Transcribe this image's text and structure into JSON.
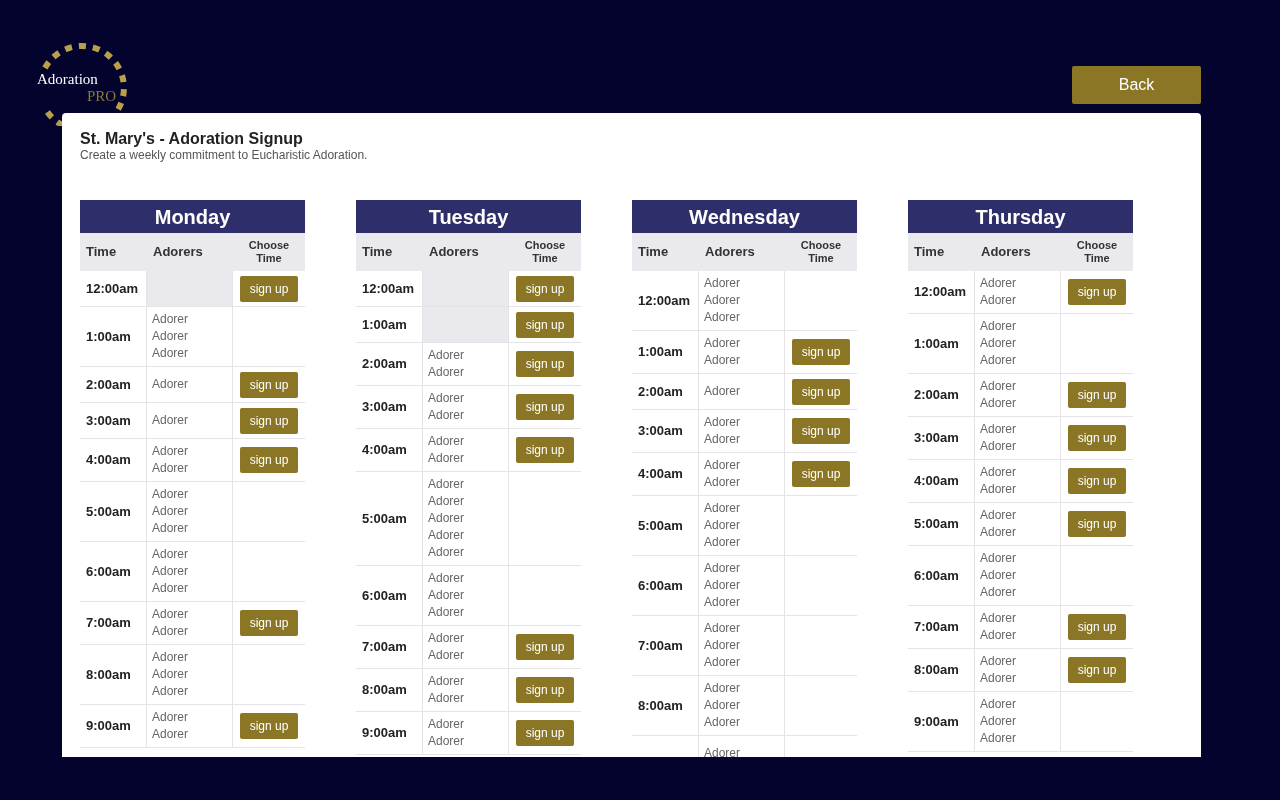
{
  "logo": {
    "line1": "Adoration",
    "line2": "PRO"
  },
  "back_button": "Back",
  "page": {
    "title": "St. Mary's - Adoration Signup",
    "subtitle": "Create a weekly commitment to Eucharistic Adoration."
  },
  "days": [
    {
      "name": "Monday",
      "columns": [
        "Time",
        "Adorers",
        "Choose Time"
      ],
      "rows": [
        {
          "time": "12:00am",
          "adorers": [],
          "action": "sign up"
        },
        {
          "time": "1:00am",
          "adorers": [
            "Adorer",
            "Adorer",
            "Adorer"
          ]
        },
        {
          "time": "2:00am",
          "adorers": [
            "Adorer"
          ],
          "action": "sign up"
        },
        {
          "time": "3:00am",
          "adorers": [
            "Adorer"
          ],
          "action": "sign up"
        },
        {
          "time": "4:00am",
          "adorers": [
            "Adorer",
            "Adorer"
          ],
          "action": "sign up"
        },
        {
          "time": "5:00am",
          "adorers": [
            "Adorer",
            "Adorer",
            "Adorer"
          ]
        },
        {
          "time": "6:00am",
          "adorers": [
            "Adorer",
            "Adorer",
            "Adorer"
          ]
        },
        {
          "time": "7:00am",
          "adorers": [
            "Adorer",
            "Adorer"
          ],
          "action": "sign up"
        },
        {
          "time": "8:00am",
          "adorers": [
            "Adorer",
            "Adorer",
            "Adorer"
          ]
        },
        {
          "time": "9:00am",
          "adorers": [
            "Adorer",
            "Adorer"
          ],
          "action": "sign up"
        }
      ]
    },
    {
      "name": "Tuesday",
      "columns": [
        "Time",
        "Adorers",
        "Choose Time"
      ],
      "rows": [
        {
          "time": "12:00am",
          "adorers": [],
          "action": "sign up"
        },
        {
          "time": "1:00am",
          "adorers": [],
          "action": "sign up"
        },
        {
          "time": "2:00am",
          "adorers": [
            "Adorer",
            "Adorer"
          ],
          "action": "sign up"
        },
        {
          "time": "3:00am",
          "adorers": [
            "Adorer",
            "Adorer"
          ],
          "action": "sign up"
        },
        {
          "time": "4:00am",
          "adorers": [
            "Adorer",
            "Adorer"
          ],
          "action": "sign up"
        },
        {
          "time": "5:00am",
          "adorers": [
            "Adorer",
            "Adorer",
            "Adorer",
            "Adorer",
            "Adorer"
          ]
        },
        {
          "time": "6:00am",
          "adorers": [
            "Adorer",
            "Adorer",
            "Adorer"
          ]
        },
        {
          "time": "7:00am",
          "adorers": [
            "Adorer",
            "Adorer"
          ],
          "action": "sign up"
        },
        {
          "time": "8:00am",
          "adorers": [
            "Adorer",
            "Adorer"
          ],
          "action": "sign up"
        },
        {
          "time": "9:00am",
          "adorers": [
            "Adorer",
            "Adorer"
          ],
          "action": "sign up"
        }
      ]
    },
    {
      "name": "Wednesday",
      "columns": [
        "Time",
        "Adorers",
        "Choose Time"
      ],
      "rows": [
        {
          "time": "12:00am",
          "adorers": [
            "Adorer",
            "Adorer",
            "Adorer"
          ]
        },
        {
          "time": "1:00am",
          "adorers": [
            "Adorer",
            "Adorer"
          ],
          "action": "sign up"
        },
        {
          "time": "2:00am",
          "adorers": [
            "Adorer"
          ],
          "action": "sign up"
        },
        {
          "time": "3:00am",
          "adorers": [
            "Adorer",
            "Adorer"
          ],
          "action": "sign up"
        },
        {
          "time": "4:00am",
          "adorers": [
            "Adorer",
            "Adorer"
          ],
          "action": "sign up"
        },
        {
          "time": "5:00am",
          "adorers": [
            "Adorer",
            "Adorer",
            "Adorer"
          ]
        },
        {
          "time": "6:00am",
          "adorers": [
            "Adorer",
            "Adorer",
            "Adorer"
          ]
        },
        {
          "time": "7:00am",
          "adorers": [
            "Adorer",
            "Adorer",
            "Adorer"
          ]
        },
        {
          "time": "8:00am",
          "adorers": [
            "Adorer",
            "Adorer",
            "Adorer"
          ]
        },
        {
          "adorers": [
            "Adorer"
          ]
        }
      ]
    },
    {
      "name": "Thursday",
      "columns": [
        "Time",
        "Adorers",
        "Choose Time"
      ],
      "rows": [
        {
          "time": "12:00am",
          "adorers": [
            "Adorer",
            "Adorer"
          ],
          "action": "sign up"
        },
        {
          "time": "1:00am",
          "adorers": [
            "Adorer",
            "Adorer",
            "Adorer"
          ]
        },
        {
          "time": "2:00am",
          "adorers": [
            "Adorer",
            "Adorer"
          ],
          "action": "sign up"
        },
        {
          "time": "3:00am",
          "adorers": [
            "Adorer",
            "Adorer"
          ],
          "action": "sign up"
        },
        {
          "time": "4:00am",
          "adorers": [
            "Adorer",
            "Adorer"
          ],
          "action": "sign up"
        },
        {
          "time": "5:00am",
          "adorers": [
            "Adorer",
            "Adorer"
          ],
          "action": "sign up"
        },
        {
          "time": "6:00am",
          "adorers": [
            "Adorer",
            "Adorer",
            "Adorer"
          ]
        },
        {
          "time": "7:00am",
          "adorers": [
            "Adorer",
            "Adorer"
          ],
          "action": "sign up"
        },
        {
          "time": "8:00am",
          "adorers": [
            "Adorer",
            "Adorer"
          ],
          "action": "sign up"
        },
        {
          "time": "9:00am",
          "adorers": [
            "Adorer",
            "Adorer",
            "Adorer"
          ]
        }
      ]
    }
  ]
}
